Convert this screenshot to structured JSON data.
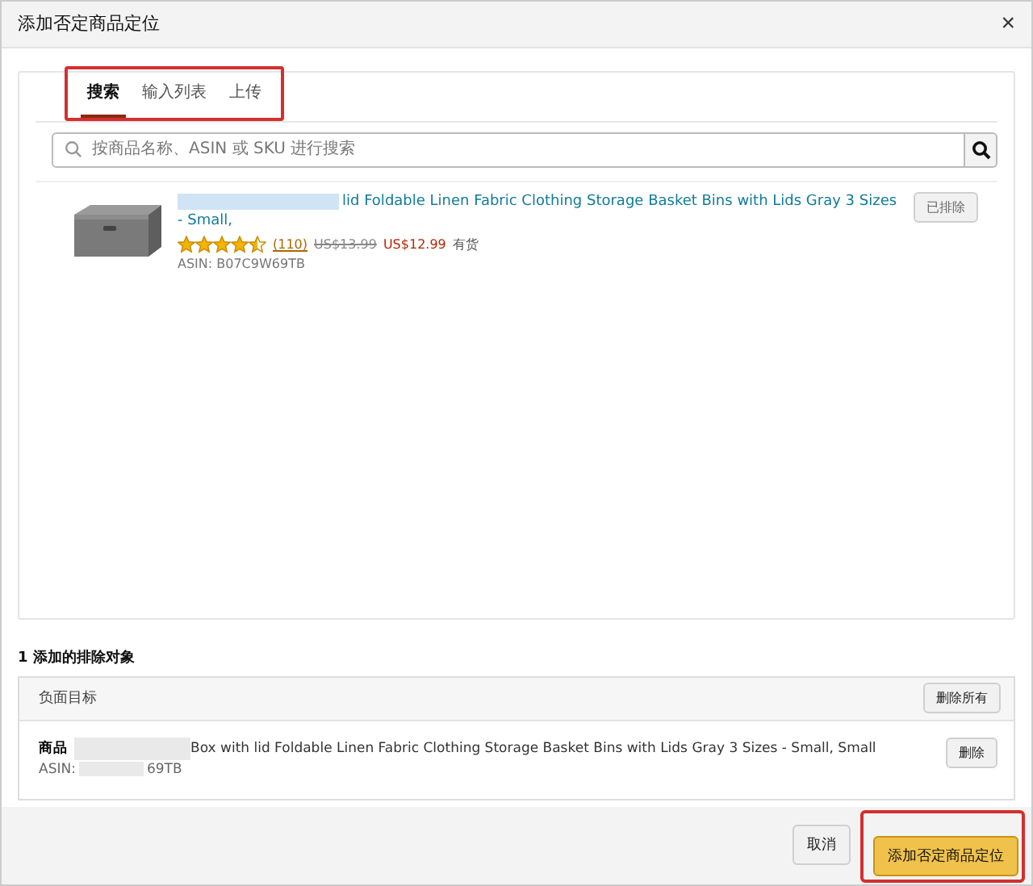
{
  "window": {
    "title": "添加否定商品定位",
    "close": "×"
  },
  "tabs": [
    {
      "label": "搜索",
      "selected": true
    },
    {
      "label": "输入列表",
      "selected": false
    },
    {
      "label": "上传",
      "selected": false
    }
  ],
  "search": {
    "placeholder": "按商品名称、ASIN 或 SKU 进行搜索"
  },
  "results": [
    {
      "title": "lid Foldable Linen Fabric Clothing Storage Basket Bins with Lids Gray 3 Sizes - Small,",
      "stars": 4.5,
      "reviews": "(110)",
      "old_price": "US$13.99",
      "price": "US$12.99",
      "stock": "有货",
      "asin": "ASIN: B07C9W69TB",
      "button": "已排除",
      "disabled": true
    }
  ],
  "added": {
    "heading": "1 添加的排除对象",
    "header": "负面目标",
    "remove_all": "删除所有",
    "items": [
      {
        "label": "商品",
        "title": "Box with lid Foldable Linen Fabric Clothing Storage Basket Bins with Lids Gray 3 Sizes - Small, Small",
        "asin_label": "ASIN:",
        "asin_tail": "69TB",
        "button": "删除"
      }
    ]
  },
  "footer": {
    "cancel": "取消",
    "submit": "添加否定商品定位"
  }
}
